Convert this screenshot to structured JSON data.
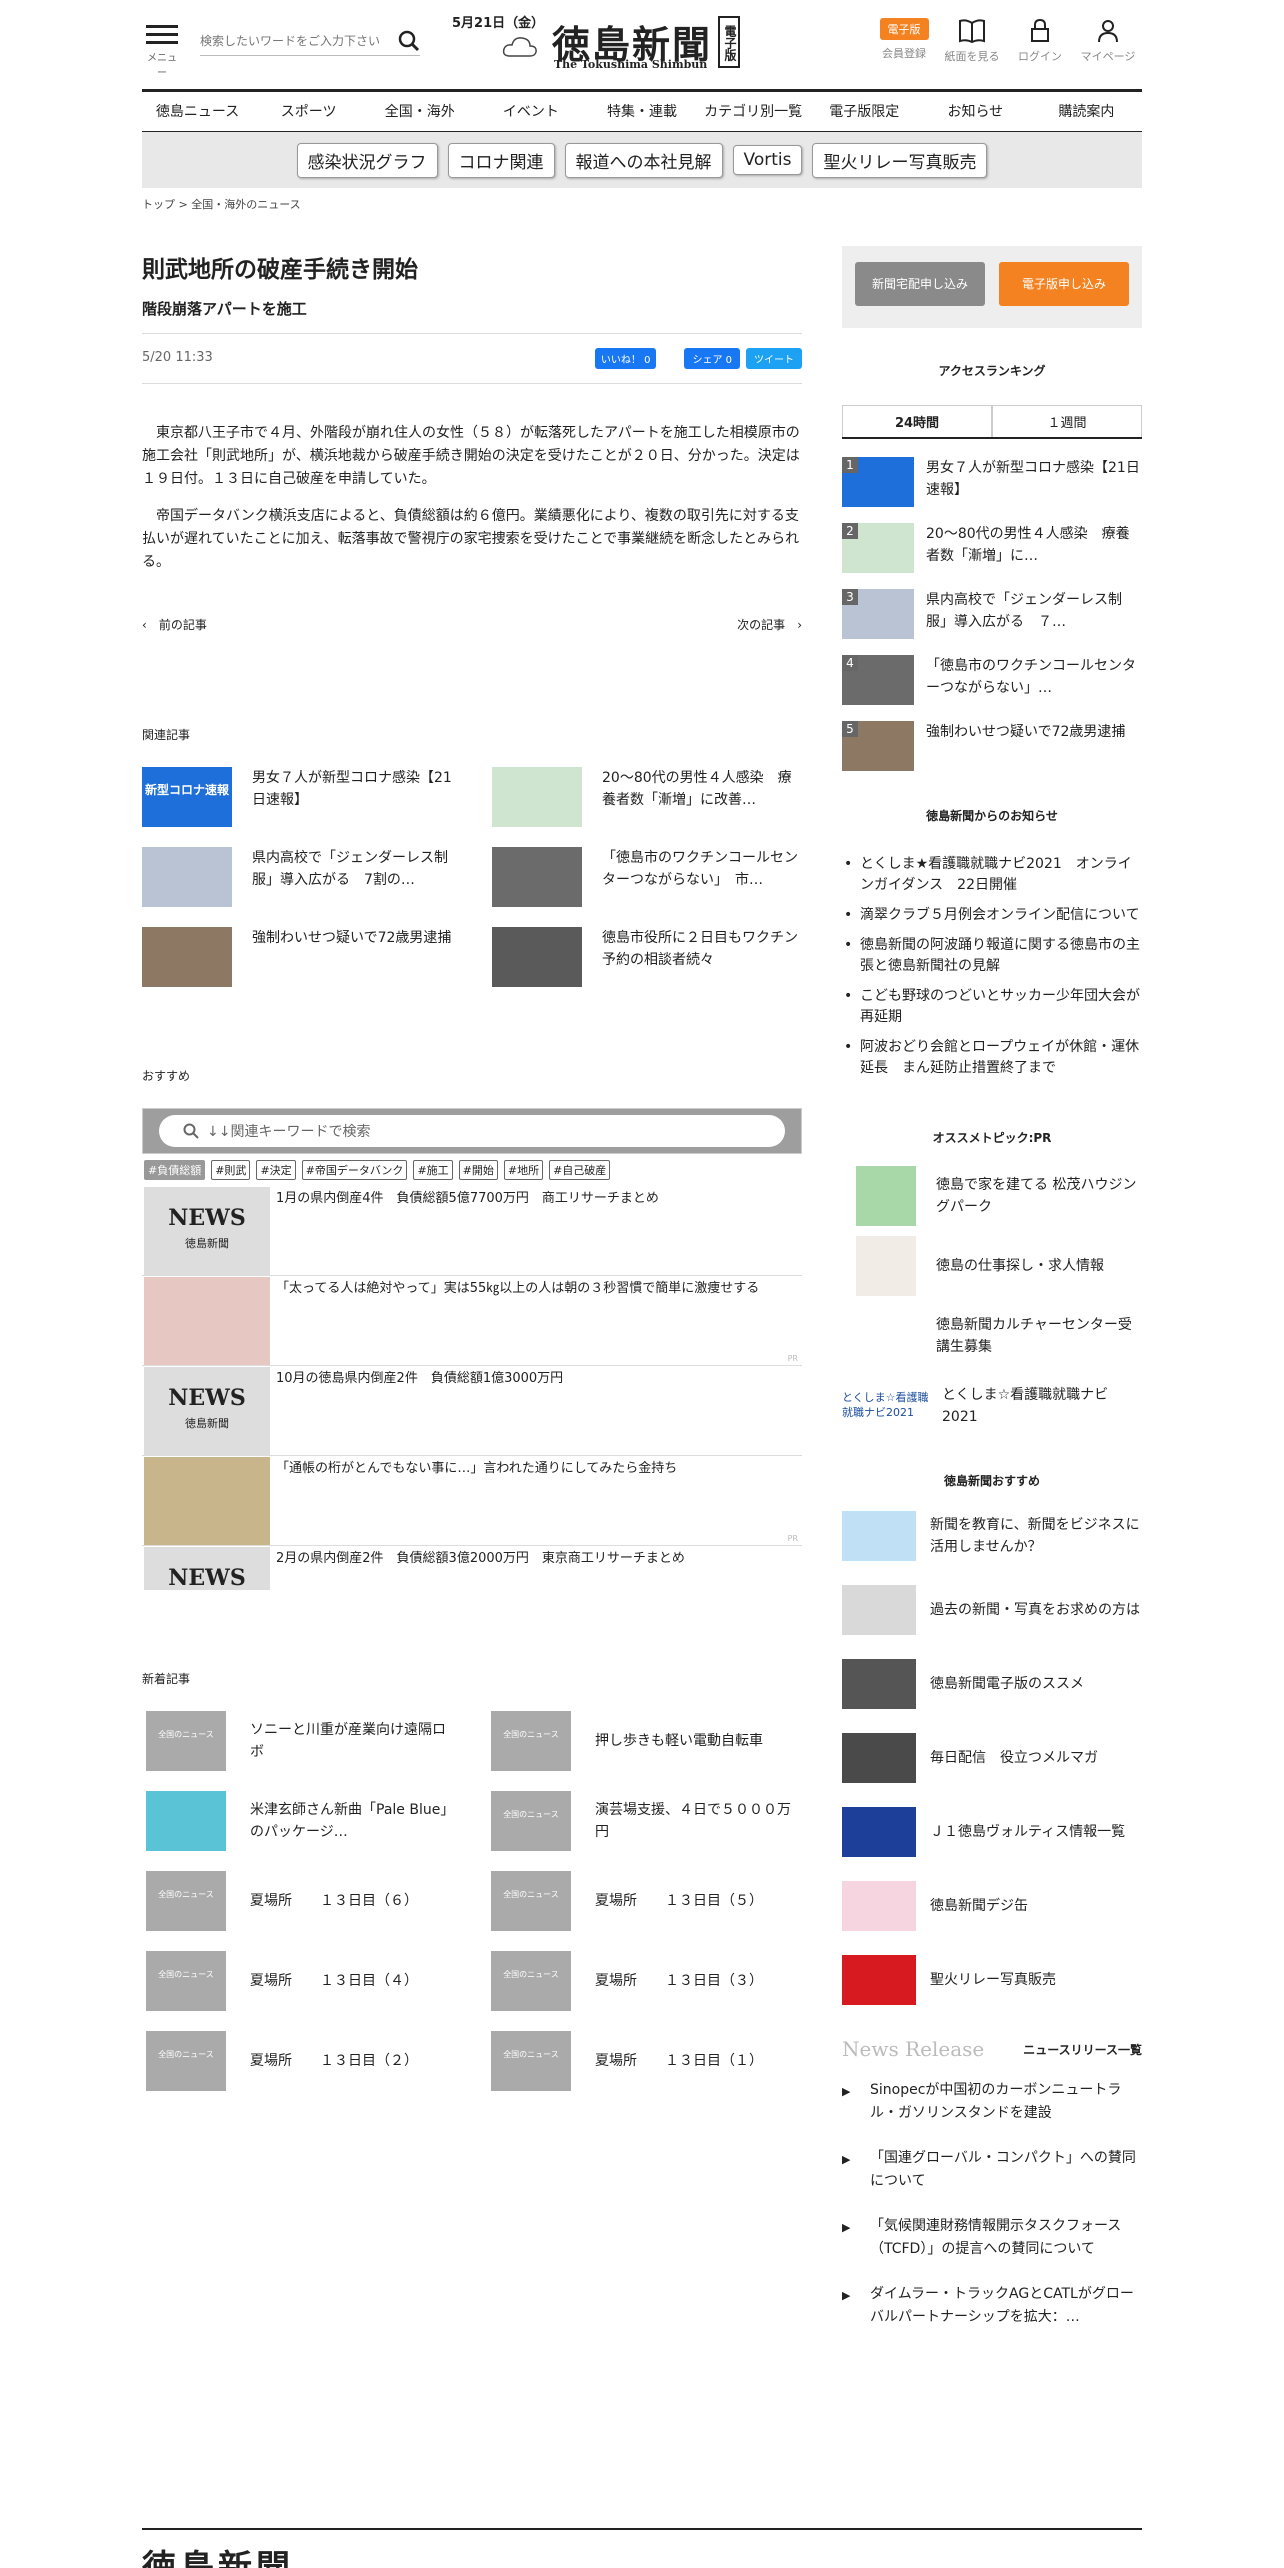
{
  "header": {
    "menu_label": "メニュー",
    "search_placeholder": "検索したいワードをご入力下さい",
    "date": "5月21日（金）",
    "logo_name": "徳島新聞",
    "logo_en": "The Tokushima Shimbun",
    "logo_badge": "電子版",
    "epaper_badge": "電子版",
    "member_register": "会員登録",
    "paper_view": "紙面を見る",
    "login": "ログイン",
    "mypage": "マイページ"
  },
  "nav": [
    "徳島ニュース",
    "スポーツ",
    "全国・海外",
    "イベント",
    "特集・連載",
    "カテゴリ別一覧",
    "電子版限定",
    "お知らせ",
    "購読案内"
  ],
  "tags": [
    "感染状況グラフ",
    "コロナ関連",
    "報道への本社見解",
    "Vortis",
    "聖火リレー写真販売"
  ],
  "breadcrumb": {
    "home": "トップ",
    "sep": ">",
    "current": "全国・海外のニュース"
  },
  "article": {
    "title": "則武地所の破産手続き開始",
    "subtitle": "階段崩落アパートを施工",
    "date": "5/20 11:33",
    "like": "いいね！ 0",
    "share": "シェア 0",
    "tweet": "ツイート",
    "p1": "東京都八王子市で４月、外階段が崩れ住人の女性（５８）が転落死したアパートを施工した相模原市の施工会社「則武地所」が、横浜地裁から破産手続き開始の決定を受けたことが２０日、分かった。決定は１９日付。１３日に自己破産を申請していた。",
    "p2": "帝国データバンク横浜支店によると、負債総額は約６億円。業績悪化により、複数の取引先に対する支払いが遅れていたことに加え、転落事故で警視庁の家宅捜索を受けたことで事業継続を断念したとみられる。",
    "prev": "前の記事",
    "next": "次の記事"
  },
  "related": {
    "heading": "関連記事",
    "items": [
      {
        "title": "男女７人が新型コロナ感染【21日速報】",
        "thumb": "新型コロナ速報"
      },
      {
        "title": "20～80代の男性４人感染　療養者数「漸増」に改善…",
        "thumb": ""
      },
      {
        "title": "県内高校で「ジェンダーレス制服」導入広がる　7割の…",
        "thumb": ""
      },
      {
        "title": "「徳島市のワクチンコールセンターつながらない」　市…",
        "thumb": ""
      },
      {
        "title": "強制わいせつ疑いで72歳男逮捕",
        "thumb": ""
      },
      {
        "title": "徳島市役所に２日目もワクチン予約の相談者続々",
        "thumb": ""
      }
    ]
  },
  "recommend": {
    "heading": "おすすめ",
    "search_placeholder": "↓↓関連キーワードで検索",
    "keywords": [
      "#負債総額",
      "#則武",
      "#決定",
      "#帝国データバンク",
      "#施工",
      "#開始",
      "#地所",
      "#自己破産"
    ],
    "news_text": "NEWS",
    "news_sub": "徳島新聞",
    "pr": "PR",
    "items": [
      {
        "title": "1月の県内倒産4件　負債総額5億7700万円　商工リサーチまとめ"
      },
      {
        "title": "「太ってる人は絶対やって」実は55㎏以上の人は朝の３秒習慣で簡単に激痩せする"
      },
      {
        "title": "10月の徳島県内倒産2件　負債総額1億3000万円"
      },
      {
        "title": "「通帳の桁がとんでもない事に…」言われた通りにしてみたら金持ち"
      },
      {
        "title": "2月の県内倒産2件　負債総額3億2000万円　東京商工リサーチまとめ"
      }
    ]
  },
  "latest": {
    "heading": "新着記事",
    "thumb_text": "全国のニュース",
    "items": [
      "ソニーと川重が産業向け遠隔ロボ",
      "押し歩きも軽い電動自転車",
      "米津玄師さん新曲「Pale Blue」のパッケージ…",
      "演芸場支援、４日で５０００万円",
      "夏場所　　１３日目（６）",
      "夏場所　　１３日目（５）",
      "夏場所　　１３日目（４）",
      "夏場所　　１３日目（３）",
      "夏場所　　１３日目（２）",
      "夏場所　　１３日目（１）"
    ]
  },
  "side": {
    "delivery": "新聞宅配申し込み",
    "epaper_apply": "電子版申し込み",
    "ranking_heading": "アクセスランキング",
    "tab_24h": "24時間",
    "tab_week": "１週間",
    "ranking": [
      {
        "n": "1",
        "title": "男女７人が新型コロナ感染【21日速報】"
      },
      {
        "n": "2",
        "title": "20～80代の男性４人感染　療養者数「漸増」に…"
      },
      {
        "n": "3",
        "title": "県内高校で「ジェンダーレス制服」導入広がる　７…"
      },
      {
        "n": "4",
        "title": "「徳島市のワクチンコールセンターつながらない」…"
      },
      {
        "n": "5",
        "title": "強制わいせつ疑いで72歳男逮捕"
      }
    ],
    "notice_heading": "徳島新聞からのお知らせ",
    "notices": [
      "とくしま★看護職就職ナビ2021　オンラインガイダンス　22日開催",
      "滴翠クラブ５月例会オンライン配信について",
      "徳島新聞の阿波踊り報道に関する徳島市の主張と徳島新聞社の見解",
      "こども野球のつどいとサッカー少年団大会が再延期",
      "阿波おどり会館とロープウェイが休館・運休延長　まん延防止措置終了まで"
    ],
    "pick_heading": "オススメトピック:PR",
    "picks": [
      "徳島で家を建てる 松茂ハウジングパーク",
      "徳島の仕事探し・求人情報",
      "徳島新聞カルチャーセンター受講生募集",
      "とくしま☆看護職就職ナビ2021"
    ],
    "pick4_logo": "とくしま☆看護職 就職ナビ2021",
    "osusume_heading": "徳島新聞おすすめ",
    "osusume": [
      "新聞を教育に、新聞をビジネスに活用しませんか？",
      "過去の新聞・写真をお求めの方は",
      "徳島新聞電子版のススメ",
      "毎日配信　役立つメルマガ",
      "Ｊ１徳島ヴォルティス情報一覧",
      "徳島新聞デジ缶",
      "聖火リレー写真販売"
    ],
    "nr_title": "News Release",
    "nr_list": "ニュースリリース一覧",
    "releases": [
      "Sinopecが中国初のカーボンニュートラル・ガソリンスタンドを建設",
      "「国連グローバル・コンパクト」への賛同について",
      "「気候関連財務情報開示タスクフォース（TCFD）」の提言への賛同について",
      "ダイムラー・トラックAGとCATLがグローバルパートナーシップを拡大：…"
    ]
  },
  "footer": {
    "logo": "徳島新聞"
  },
  "colors": {
    "accent": "#f58220",
    "fb": "#1877f2",
    "tw": "#1da1f2",
    "gray_btn": "#8a8a8a"
  }
}
